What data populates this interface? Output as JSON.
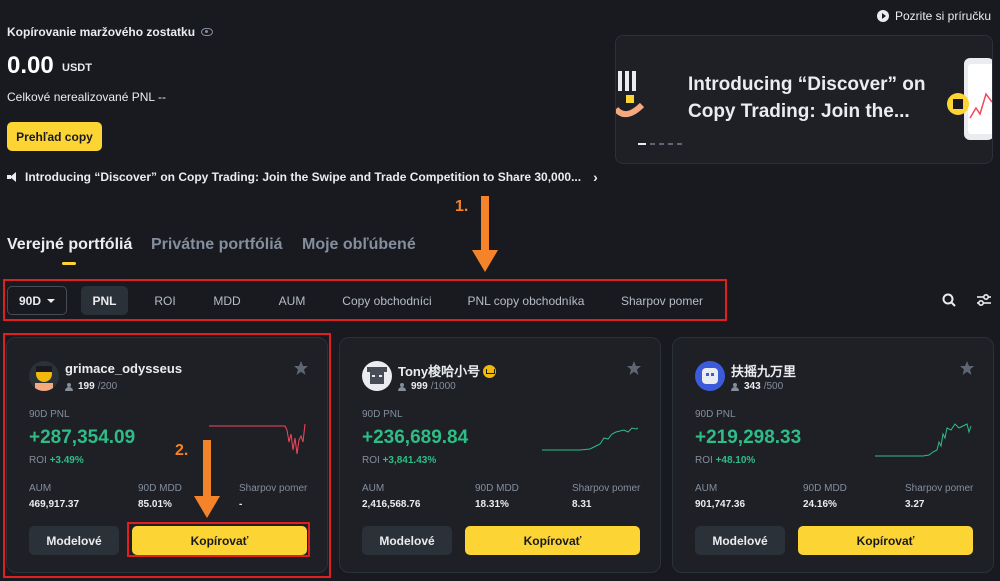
{
  "header": {
    "balance_label": "Kopírovanie maržového zostatku",
    "balance_value": "0.00",
    "balance_unit": "USDT",
    "pnl_label": "Celkové nerealizované PNL  --",
    "overview_button": "Prehľad copy",
    "announcement": "Introducing “Discover” on Copy Trading: Join the Swipe and Trade Competition to Share 30,000...",
    "announcement_chevron": "›",
    "guide_link": "Pozrite si príručku"
  },
  "banner": {
    "title": "Introducing “Discover” on Copy Trading: Join the...",
    "slides": 5,
    "active_slide": 0
  },
  "tabs": [
    {
      "label": "Verejné portfóliá",
      "active": true
    },
    {
      "label": "Privátne portfóliá",
      "active": false
    },
    {
      "label": "Moje obľúbené",
      "active": false
    }
  ],
  "filters": {
    "period": "90D",
    "items": [
      "PNL",
      "ROI",
      "MDD",
      "AUM",
      "Copy obchodníci",
      "PNL copy obchodníka",
      "Sharpov pomer"
    ],
    "active": "PNL"
  },
  "icons": {
    "search": "search-icon",
    "filter": "filter-settings-icon",
    "star": "star-icon",
    "people": "people-icon"
  },
  "cards": [
    {
      "name": "grimace_odysseus",
      "followers": "199",
      "followers_max": "/200",
      "pnl_label": "90D PNL",
      "pnl_value": "+287,354.09",
      "roi_label": "ROI",
      "roi_value": "+3.49%",
      "aum_label": "AUM",
      "aum_value": "469,917.37",
      "mdd_label": "90D MDD",
      "mdd_value": "85.01%",
      "sharpe_label": "Sharpov pomer",
      "sharpe_value": "-",
      "model_button": "Modelové",
      "copy_button": "Kopírovať"
    },
    {
      "name": "Tony梭哈小号",
      "followers": "999",
      "followers_max": "/1000",
      "pnl_label": "90D PNL",
      "pnl_value": "+236,689.84",
      "roi_label": "ROI",
      "roi_value": "+3,841.43%",
      "aum_label": "AUM",
      "aum_value": "2,416,568.76",
      "mdd_label": "90D MDD",
      "mdd_value": "18.31%",
      "sharpe_label": "Sharpov pomer",
      "sharpe_value": "8.31",
      "model_button": "Modelové",
      "copy_button": "Kopírovať"
    },
    {
      "name": "扶摇九万里",
      "followers": "343",
      "followers_max": "/500",
      "pnl_label": "90D PNL",
      "pnl_value": "+219,298.33",
      "roi_label": "ROI",
      "roi_value": "+48.10%",
      "aum_label": "AUM",
      "aum_value": "901,747.36",
      "mdd_label": "90D MDD",
      "mdd_value": "24.16%",
      "sharpe_label": "Sharpov pomer",
      "sharpe_value": "3.27",
      "model_button": "Modelové",
      "copy_button": "Kopírovať"
    }
  ],
  "annotations": {
    "step1": "1.",
    "step2": "2."
  },
  "colors": {
    "background": "#181a20",
    "card": "#1e2026",
    "accent": "#fcd535",
    "positive": "#2ebd85",
    "negative": "#f6465d",
    "annotation_box": "#e02020",
    "annotation_arrow": "#f5832a"
  }
}
